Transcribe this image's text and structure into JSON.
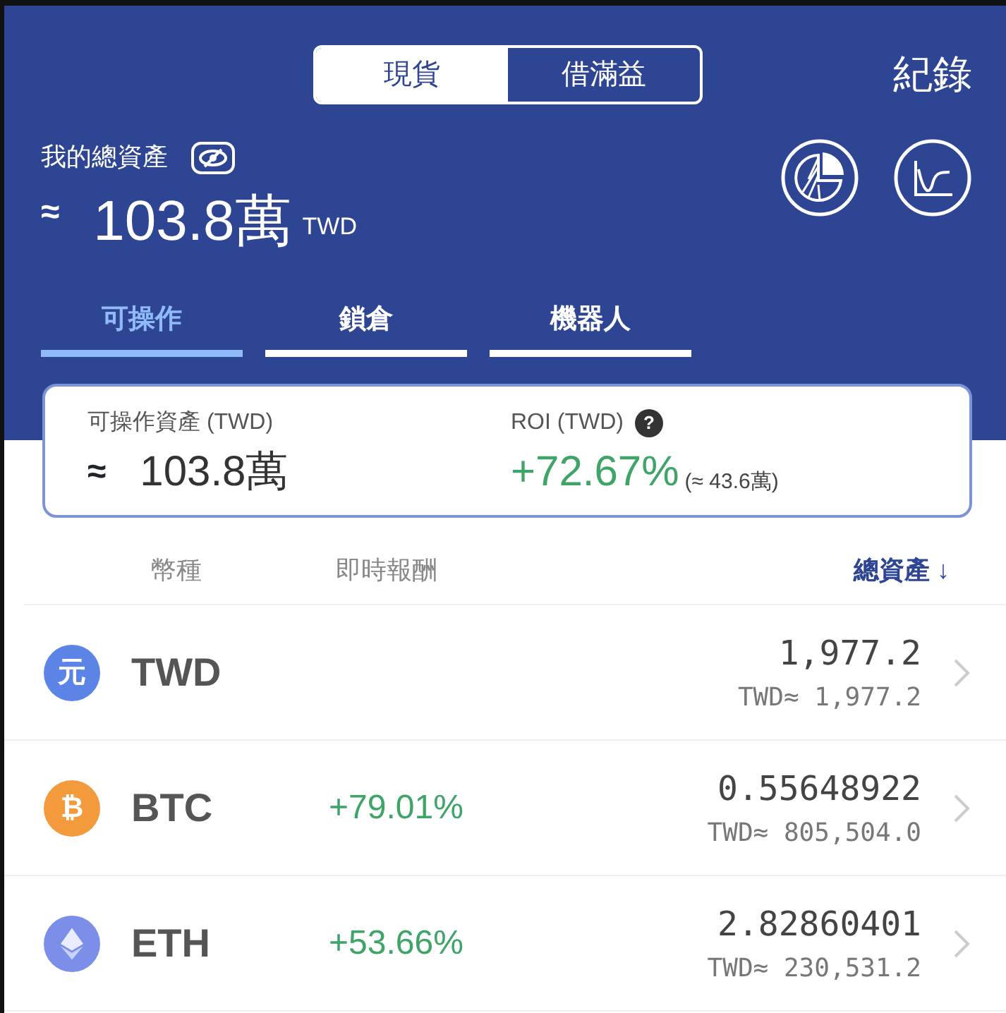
{
  "header": {
    "segments": [
      {
        "label": "現貨",
        "selected": true
      },
      {
        "label": "借滿益",
        "selected": false
      }
    ],
    "history_link": "紀錄",
    "total_label": "我的總資產",
    "approx": "≈",
    "total_value": "103.8萬",
    "total_currency": "TWD"
  },
  "tabs": [
    {
      "label": "可操作",
      "selected": true
    },
    {
      "label": "鎖倉",
      "selected": false
    },
    {
      "label": "機器人",
      "selected": false
    }
  ],
  "summary": {
    "available_label": "可操作資產 (TWD)",
    "approx": "≈",
    "available_value": "103.8萬",
    "roi_label": "ROI (TWD)",
    "help": "?",
    "roi_value": "+72.67%",
    "roi_amount": "(≈ 43.6萬)"
  },
  "columns": [
    {
      "label": "幣種",
      "sorted": false
    },
    {
      "label": "即時報酬",
      "sorted": false
    },
    {
      "label": "總資產",
      "sorted": true,
      "arrow": "↓"
    }
  ],
  "coins": [
    {
      "symbol": "TWD",
      "color": "#5b84e6",
      "icon": {
        "kind": "glyph",
        "glyph": "元"
      },
      "amount": "1,977.2",
      "value": "TWD≈ 1,977.2"
    },
    {
      "symbol": "BTC",
      "color": "#f39a3c",
      "icon": {
        "kind": "glyph",
        "glyph": "₿"
      },
      "change": "+79.01%",
      "amount": "0.55648922",
      "value": "TWD≈ 805,504.0"
    },
    {
      "symbol": "ETH",
      "color": "#7b8fe8",
      "icon": {
        "kind": "diamond"
      },
      "change": "+53.66%",
      "amount": "2.82860401",
      "value": "TWD≈ 230,531.2"
    }
  ]
}
